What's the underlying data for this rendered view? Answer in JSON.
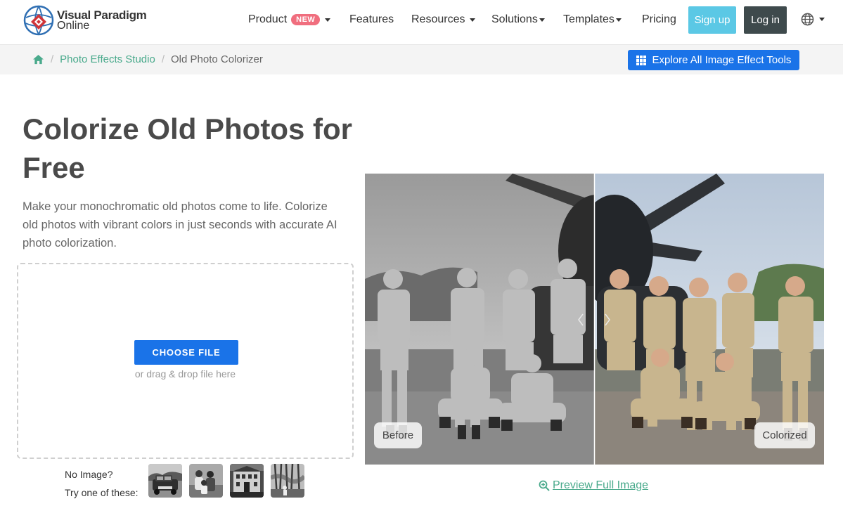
{
  "brand": {
    "line1": "Visual Paradigm",
    "line2": "Online"
  },
  "nav": {
    "product": "Product",
    "product_badge": "NEW",
    "features": "Features",
    "resources": "Resources",
    "solutions": "Solutions",
    "templates": "Templates",
    "pricing": "Pricing",
    "signup": "Sign up",
    "login": "Log in"
  },
  "breadcrumb": {
    "items": [
      "Photo Effects Studio",
      "Old Photo Colorizer"
    ],
    "separator": "/"
  },
  "explore_button": "Explore All Image Effect Tools",
  "hero": {
    "title": "Colorize Old Photos for Free",
    "description": "Make your monochromatic old photos come to life. Colorize old photos with vibrant colors in just seconds with accurate AI photo colorization."
  },
  "upload": {
    "choose_button": "CHOOSE FILE",
    "drag_hint": "or drag & drop file here"
  },
  "samples": {
    "line1": "No Image?",
    "line2": "Try one of these:"
  },
  "compare": {
    "before_label": "Before",
    "after_label": "Colorized",
    "split_percent": 50
  },
  "preview_link": "Preview Full Image",
  "colors": {
    "accent_blue": "#1a73e8",
    "link_green": "#4aaa8c",
    "signup": "#5bc8e5",
    "login": "#3e4a4c",
    "badge": "#f06e7e"
  },
  "icons": [
    "home-icon",
    "grid-icon",
    "globe-icon",
    "zoom-in-icon",
    "chevron-left-icon",
    "chevron-right-icon"
  ]
}
